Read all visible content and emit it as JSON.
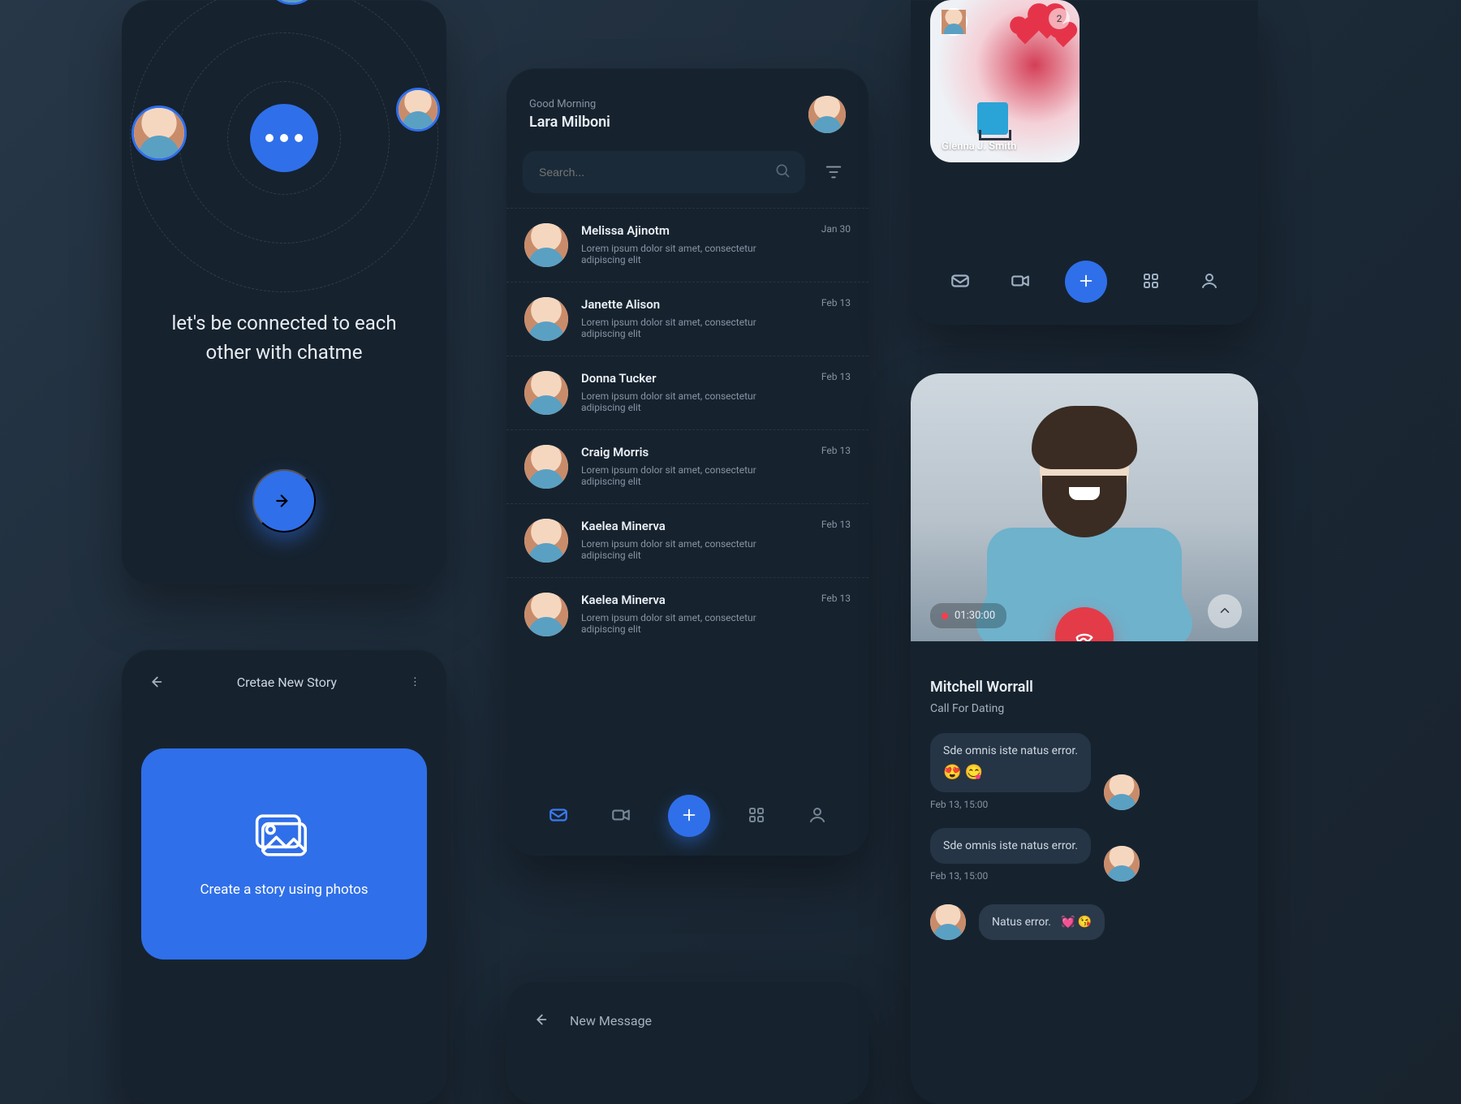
{
  "colors": {
    "accent": "#2f6fe9",
    "danger": "#e43b49",
    "bg": "#1e2c3c",
    "panel": "#16232f"
  },
  "onboard": {
    "tagline": "let's be connected to each other with chatme"
  },
  "story": {
    "title": "Cretae  New Story",
    "tile_label": "Create a story using photos"
  },
  "inbox": {
    "greeting": "Good Morning",
    "user_name": "Lara Milboni",
    "search": {
      "placeholder": "Search..."
    },
    "rows": [
      {
        "name": "Melissa Ajinotm",
        "preview": "Lorem ipsum dolor sit amet, consectetur adipiscing elit",
        "date": "Jan 30"
      },
      {
        "name": "Janette Alison",
        "preview": "Lorem ipsum dolor sit amet, consectetur adipiscing elit",
        "date": "Feb 13"
      },
      {
        "name": "Donna Tucker",
        "preview": "Lorem ipsum dolor sit amet, consectetur adipiscing elit",
        "date": "Feb 13"
      },
      {
        "name": "Craig Morris",
        "preview": "Lorem ipsum dolor sit amet, consectetur adipiscing elit",
        "date": "Feb 13"
      },
      {
        "name": "Kaelea Minerva",
        "preview": "Lorem ipsum dolor sit amet, consectetur adipiscing elit",
        "date": "Feb 13"
      },
      {
        "name": "Kaelea Minerva",
        "preview": "Lorem ipsum dolor sit amet, consectetur adipiscing elit",
        "date": "Feb 13"
      }
    ]
  },
  "newmsg": {
    "title": "New Message"
  },
  "feedtop": {
    "story_caption": "Glenna J. Smith",
    "badge": "2"
  },
  "call": {
    "timer": "01:30:00",
    "name": "Mitchell Worrall",
    "subtitle": "Call For Dating",
    "messages": [
      {
        "text": "Sde omnis iste natus error.",
        "emoji": "😍 😋",
        "time": "Feb 13, 15:00"
      },
      {
        "text": "Sde omnis iste natus error.",
        "emoji": "",
        "time": "Feb 13, 15:00"
      }
    ],
    "draft": {
      "text": "Natus error.",
      "emoji": "💓 😘"
    }
  }
}
